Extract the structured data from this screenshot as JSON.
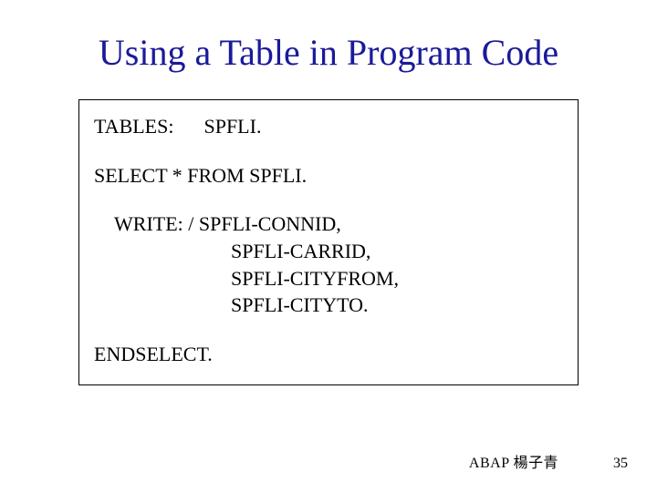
{
  "title": "Using a Table in Program Code",
  "code": {
    "l1a": "TABLES:",
    "l1b": "SPFLI.",
    "l2": "SELECT * FROM SPFLI.",
    "l3": "WRITE: / SPFLI-CONNID,",
    "l4": "SPFLI-CARRID,",
    "l5": "SPFLI-CITYFROM,",
    "l6": "SPFLI-CITYTO.",
    "l7": "ENDSELECT."
  },
  "footer": {
    "course": "ABAP 楊子青",
    "page": "35"
  }
}
